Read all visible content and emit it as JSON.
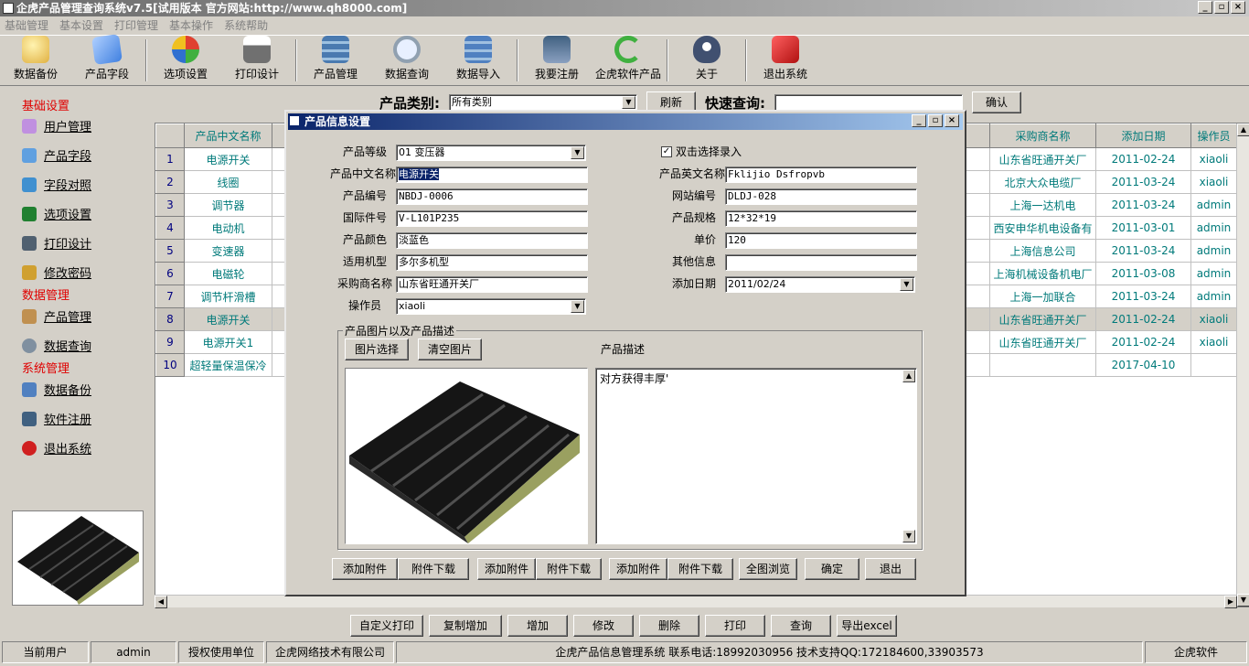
{
  "app": {
    "title": "企虎产品管理查询系统v7.5[试用版本 官方网站:http://www.qh8000.com]",
    "window_buttons": [
      "_",
      "▫",
      "×"
    ]
  },
  "menu": [
    "基础管理",
    "基本设置",
    "打印管理",
    "基本操作",
    "系统帮助"
  ],
  "toolbar": [
    {
      "label": "数据备份",
      "icon": "database-backup-icon",
      "color": "#e0b040"
    },
    {
      "label": "产品字段",
      "icon": "product-field-icon",
      "color": "#4080e0"
    },
    {
      "label": "选项设置",
      "icon": "options-icon",
      "color": "#e04030"
    },
    {
      "label": "打印设计",
      "icon": "printer-icon",
      "color": "#707070"
    },
    {
      "label": "产品管理",
      "icon": "product-manage-icon",
      "color": "#4a7ab0"
    },
    {
      "label": "数据查询",
      "icon": "magnifier-icon",
      "color": "#90a0b0"
    },
    {
      "label": "数据导入",
      "icon": "database-import-icon",
      "color": "#5080c0"
    },
    {
      "label": "我要注册",
      "icon": "register-icon",
      "color": "#406080"
    },
    {
      "label": "企虎软件产品",
      "icon": "refresh-icon",
      "color": "#40b040"
    },
    {
      "label": "关于",
      "icon": "about-icon",
      "color": "#405070"
    },
    {
      "label": "退出系统",
      "icon": "exit-icon",
      "color": "#d02020"
    }
  ],
  "sidebar": {
    "sections": [
      {
        "title": "基础设置",
        "items": [
          {
            "label": "用户管理",
            "icon": "user-icon"
          },
          {
            "label": "产品字段",
            "icon": "field-icon"
          },
          {
            "label": "字段对照",
            "icon": "mapping-icon"
          },
          {
            "label": "选项设置",
            "icon": "flag-icon"
          },
          {
            "label": "打印设计",
            "icon": "printer-icon"
          },
          {
            "label": "修改密码",
            "icon": "key-icon"
          }
        ]
      },
      {
        "title": "数据管理",
        "items": [
          {
            "label": "产品管理",
            "icon": "box-icon"
          },
          {
            "label": "数据查询",
            "icon": "search-icon"
          }
        ]
      },
      {
        "title": "系统管理",
        "items": [
          {
            "label": "数据备份",
            "icon": "backup-icon"
          },
          {
            "label": "软件注册",
            "icon": "register-icon"
          },
          {
            "label": "退出系统",
            "icon": "exit-icon"
          }
        ]
      }
    ]
  },
  "filter": {
    "category_label": "产品类别:",
    "category_value": "所有类别",
    "refresh": "刷新",
    "quick_label": "快速查询:",
    "quick_value": "",
    "confirm": "确认"
  },
  "grid": {
    "headers": {
      "name": "产品中文名称",
      "supplier": "采购商名称",
      "date": "添加日期",
      "operator": "操作员"
    },
    "rows": [
      {
        "n": "1",
        "name": "电源开关",
        "supplier": "山东省旺通开关厂",
        "date": "2011-02-24",
        "op": "xiaoli"
      },
      {
        "n": "2",
        "name": "线圈",
        "supplier": "北京大众电缆厂",
        "date": "2011-03-24",
        "op": "xiaoli"
      },
      {
        "n": "3",
        "name": "调节器",
        "supplier": "上海一达机电",
        "date": "2011-03-24",
        "op": "admin"
      },
      {
        "n": "4",
        "name": "电动机",
        "supplier": "西安申华机电设备有",
        "date": "2011-03-01",
        "op": "admin"
      },
      {
        "n": "5",
        "name": "变速器",
        "supplier": "上海信息公司",
        "date": "2011-03-24",
        "op": "admin"
      },
      {
        "n": "6",
        "name": "电磁轮",
        "supplier": "上海机械设备机电厂",
        "date": "2011-03-08",
        "op": "admin"
      },
      {
        "n": "7",
        "name": "调节杆滑槽",
        "supplier": "上海一加联合",
        "date": "2011-03-24",
        "op": "admin"
      },
      {
        "n": "8",
        "name": "电源开关",
        "supplier": "山东省旺通开关厂",
        "date": "2011-02-24",
        "op": "xiaoli"
      },
      {
        "n": "9",
        "name": "电源开关1",
        "supplier": "山东省旺通开关厂",
        "date": "2011-02-24",
        "op": "xiaoli"
      },
      {
        "n": "10",
        "name": "超轻量保温保冷",
        "supplier": "",
        "date": "2017-04-10",
        "op": ""
      }
    ]
  },
  "dialog": {
    "title": "产品信息设置",
    "fields": {
      "grade_label": "产品等级",
      "grade": "01  变压器",
      "cn_name_label": "产品中文名称",
      "cn_name": "电源开关",
      "code_label": "产品编号",
      "code": "NBDJ-0006",
      "intl_label": "国际件号",
      "intl": "V-L101P235",
      "color_label": "产品颜色",
      "color": "淡蓝色",
      "model_label": "适用机型",
      "model": "多尔多机型",
      "supplier_label": "采购商名称",
      "supplier": "山东省旺通开关厂",
      "operator_label": "操作员",
      "operator": "xiaoli",
      "dblclick_label": "双击选择录入",
      "en_name_label": "产品英文名称",
      "en_name": "Fklijio Dsfropvb",
      "web_code_label": "网站编号",
      "web_code": "DLDJ-028",
      "spec_label": "产品规格",
      "spec": "12*32*19",
      "price_label": "单价",
      "price": "120",
      "other_label": "其他信息",
      "other": "",
      "date_label": "添加日期",
      "date": "2011/02/24"
    },
    "group_label": "产品图片以及产品描述",
    "pick_image": "图片选择",
    "clear_image": "清空图片",
    "desc_label": "产品描述",
    "desc": "对方获得丰厚'",
    "buttons": [
      "添加附件",
      "附件下载",
      "添加附件",
      "附件下载",
      "添加附件",
      "附件下载",
      "全图浏览",
      "确定",
      "退出"
    ]
  },
  "actions": [
    "自定义打印",
    "复制增加",
    "增加",
    "修改",
    "删除",
    "打印",
    "查询",
    "导出excel"
  ],
  "status": {
    "user_label": "当前用户",
    "user": "admin",
    "licensee_label": "授权使用单位",
    "licensee": "企虎网络技术有限公司",
    "info": "企虎产品信息管理系统   联系电话:18992030956   技术支持QQ:172184600,33903573",
    "brand": "企虎软件"
  }
}
